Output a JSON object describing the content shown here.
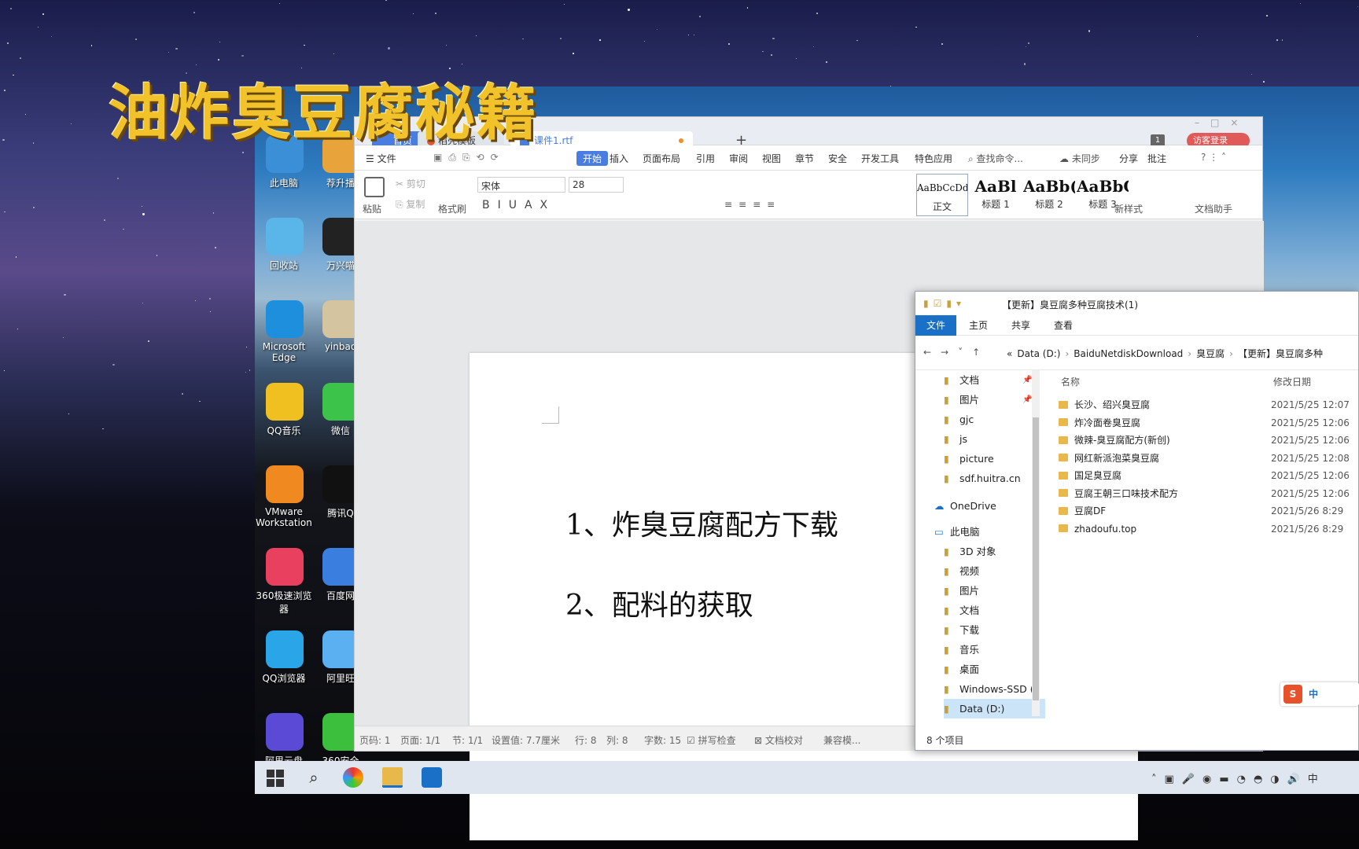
{
  "banner": {
    "title": "油炸臭豆腐秘籍"
  },
  "desktop_icons": [
    {
      "label": "此电脑"
    },
    {
      "label": "荐升播"
    },
    {
      "label": "回收站"
    },
    {
      "label": "万兴喵"
    },
    {
      "label": "Microsoft Edge"
    },
    {
      "label": "yinbao"
    },
    {
      "label": "QQ音乐"
    },
    {
      "label": "微信"
    },
    {
      "label": "VMware Workstation"
    },
    {
      "label": "腾讯Q"
    },
    {
      "label": "360极速浏览器"
    },
    {
      "label": "百度网"
    },
    {
      "label": "QQ浏览器"
    },
    {
      "label": "阿里旺"
    },
    {
      "label": "阿里云盘"
    },
    {
      "label": "360安全"
    }
  ],
  "wps": {
    "tabs": {
      "home": "首页",
      "template": "稻壳模板",
      "doc": "课件1.rtf",
      "new_tab": "+"
    },
    "badge": "1",
    "login": "访客登录",
    "menu": {
      "file": "文件",
      "items": [
        "开始",
        "插入",
        "页面布局",
        "引用",
        "审阅",
        "视图",
        "章节",
        "安全",
        "开发工具",
        "特色应用"
      ],
      "search": "查找命令...",
      "sync": "未同步",
      "share": "分享",
      "comment": "批注"
    },
    "ribbon": {
      "paste": "粘贴",
      "cut": "剪切",
      "copy": "复制",
      "format_painter": "格式刷",
      "font_name": "宋体",
      "font_size": "28",
      "styles": [
        {
          "preview": "AaBbCcDd",
          "label": "正文"
        },
        {
          "preview": "AaBl",
          "label": "标题 1"
        },
        {
          "preview": "AaBb(",
          "label": "标题 2"
        },
        {
          "preview": "AaBbC",
          "label": "标题 3"
        }
      ],
      "new_style": "新样式",
      "doc_assistant": "文档助手"
    },
    "document": {
      "line1": "1、炸臭豆腐配方下载",
      "line2": "2、配料的获取"
    },
    "status": {
      "page_code": "页码: 1",
      "pages": "页面: 1/1",
      "section": "节: 1/1",
      "setting": "设置值: 7.7厘米",
      "row": "行: 8",
      "col": "列: 8",
      "words": "字数: 15",
      "spell": "拼写检查",
      "proof": "文档校对",
      "compat": "兼容模..."
    }
  },
  "explorer": {
    "title": "【更新】臭豆腐多种豆腐技术(1)",
    "tabs": [
      "文件",
      "主页",
      "共享",
      "查看"
    ],
    "breadcrumb": [
      "«",
      "Data (D:)",
      "BaiduNetdiskDownload",
      "臭豆腐",
      "【更新】臭豆腐多种"
    ],
    "nav": [
      {
        "label": "文档",
        "pinned": true
      },
      {
        "label": "图片",
        "pinned": true
      },
      {
        "label": "gjc"
      },
      {
        "label": "js"
      },
      {
        "label": "picture"
      },
      {
        "label": "sdf.huitra.cn"
      },
      {
        "label": "OneDrive"
      },
      {
        "label": "此电脑"
      },
      {
        "label": "3D 对象"
      },
      {
        "label": "视频"
      },
      {
        "label": "图片"
      },
      {
        "label": "文档"
      },
      {
        "label": "下载"
      },
      {
        "label": "音乐"
      },
      {
        "label": "桌面"
      },
      {
        "label": "Windows-SSD ("
      },
      {
        "label": "Data (D:)"
      }
    ],
    "columns": {
      "name": "名称",
      "date": "修改日期"
    },
    "files": [
      {
        "name": "长沙、绍兴臭豆腐",
        "date": "2021/5/25 12:07"
      },
      {
        "name": "炸冷面卷臭豆腐",
        "date": "2021/5/25 12:06"
      },
      {
        "name": "微辣-臭豆腐配方(新创)",
        "date": "2021/5/25 12:06"
      },
      {
        "name": "网红新派泡菜臭豆腐",
        "date": "2021/5/25 12:08"
      },
      {
        "name": "国足臭豆腐",
        "date": "2021/5/25 12:06"
      },
      {
        "name": "豆腐王朝三口味技术配方",
        "date": "2021/5/25 12:06"
      },
      {
        "name": "豆腐DF",
        "date": "2021/5/26 8:29"
      },
      {
        "name": "zhadoufu.top",
        "date": "2021/5/26 8:29"
      }
    ],
    "item_count": "8 个项目"
  },
  "ime": {
    "label": "中"
  },
  "colors": {
    "banner": "#f2c22a",
    "wps_accent": "#4a7de2",
    "explorer_accent": "#1a6fc7",
    "login": "#e05a5a"
  }
}
